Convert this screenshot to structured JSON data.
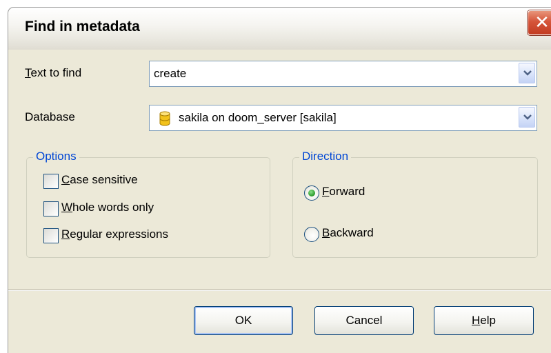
{
  "window": {
    "title": "Find in metadata",
    "close_icon": "close-icon"
  },
  "text_to_find": {
    "label_mnemonic": "T",
    "label_rest": "ext to find",
    "value": "create"
  },
  "database": {
    "label": "Database",
    "value": "sakila on doom_server [sakila]",
    "icon": "database-icon"
  },
  "options": {
    "title": "Options",
    "case_sensitive": {
      "mnemonic": "C",
      "rest": "ase sensitive",
      "checked": false
    },
    "whole_words": {
      "mnemonic": "W",
      "rest": "hole words only",
      "checked": false
    },
    "regex": {
      "mnemonic": "R",
      "rest": "egular expressions",
      "checked": false
    }
  },
  "direction": {
    "title": "Direction",
    "forward": {
      "mnemonic": "F",
      "rest": "orward",
      "selected": true
    },
    "backward": {
      "mnemonic": "B",
      "rest": "ackward",
      "selected": false
    }
  },
  "buttons": {
    "ok": "OK",
    "cancel": "Cancel",
    "help_mnemonic": "H",
    "help_rest": "elp"
  },
  "colors": {
    "dialog_bg": "#ece9d8",
    "group_title": "#0046d5",
    "input_border": "#7f9db9",
    "close_red": "#d5553a"
  }
}
